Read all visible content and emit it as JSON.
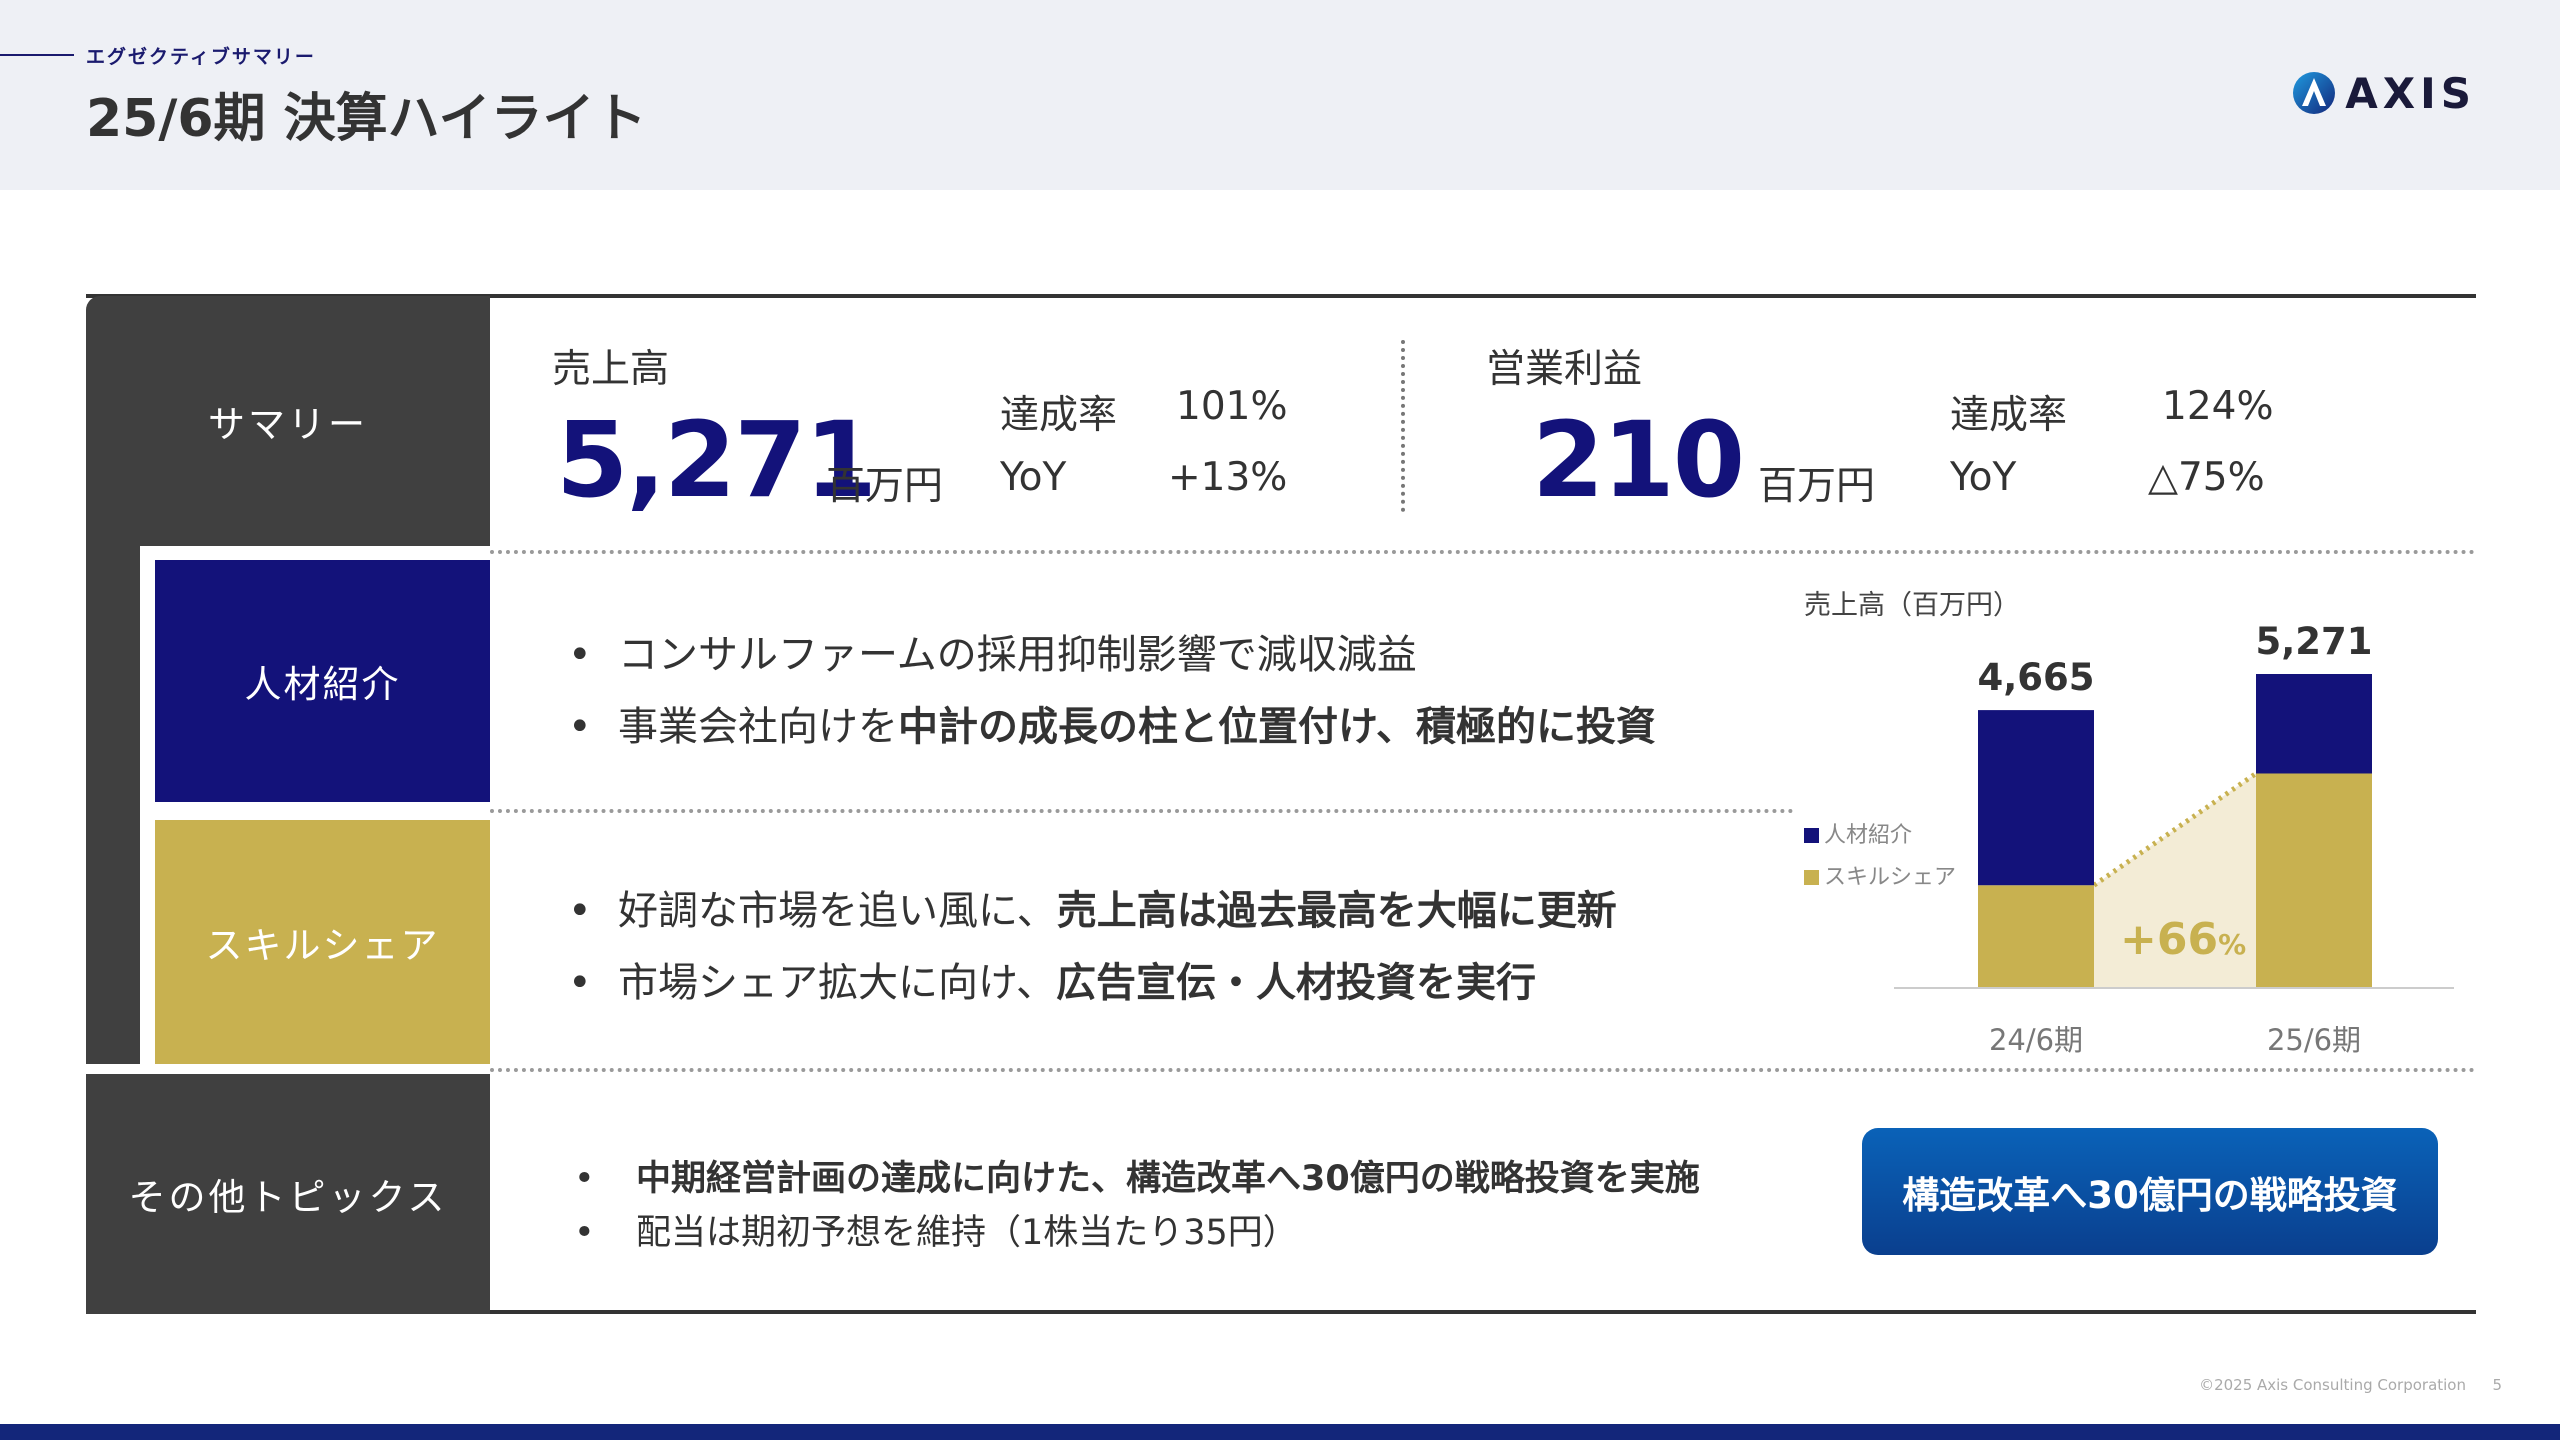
{
  "header": {
    "section_label": "エグゼクティブサマリー",
    "title": "25/6期 決算ハイライト",
    "logo_text": "AXIS",
    "logo_icon": "axis-logo-icon"
  },
  "summary": {
    "label": "サマリー",
    "sales": {
      "title": "売上高",
      "value": "5,271",
      "unit": "百万円",
      "achievement_label": "達成率",
      "achievement_value": "101%",
      "yoy_label": "YoY",
      "yoy_value": "+13%"
    },
    "op_income": {
      "title": "営業利益",
      "value": "210",
      "unit": "百万円",
      "achievement_label": "達成率",
      "achievement_value": "124%",
      "yoy_label": "YoY",
      "yoy_value": "△75%"
    }
  },
  "segments": {
    "talent": {
      "label": "人材紹介",
      "bullet1": "コンサルファームの採用抑制影響で減収減益",
      "bullet2_prefix": "事業会社向けを",
      "bullet2_bold": "中計の成長の柱と位置付け、積極的に投資"
    },
    "skillshare": {
      "label": "スキルシェア",
      "bullet1_prefix": "好調な市場を追い風に、",
      "bullet1_bold": "売上高は過去最高を大幅に更新",
      "bullet2_prefix": "市場シェア拡大に向け、",
      "bullet2_bold": "広告宣伝・人材投資を実行"
    }
  },
  "other": {
    "label": "その他トピックス",
    "bullet1": "中期経営計画の達成に向けた、構造改革へ30億円の戦略投資を実施",
    "bullet2": "配当は期初予想を維持（1株当たり35円）",
    "cta_label": "構造改革へ30億円の戦略投資"
  },
  "bullet_char": "•",
  "chart_data": {
    "type": "bar",
    "title": "売上高（百万円）",
    "categories": [
      "24/6期",
      "25/6期"
    ],
    "stacked": true,
    "series": [
      {
        "name": "人材紹介",
        "color": "#13127a",
        "values": [
          2940,
          1670
        ]
      },
      {
        "name": "スキルシェア",
        "color": "#c8b150",
        "values": [
          1725,
          3601
        ]
      }
    ],
    "totals": [
      4665,
      5271
    ],
    "total_labels": [
      "4,665",
      "5,271"
    ],
    "annotation": {
      "text": "+66",
      "suffix": "%",
      "series": "スキルシェア"
    },
    "ylim": [
      0,
      5271
    ],
    "legend": "left",
    "grid": false
  },
  "footer": {
    "copyright": "©2025 Axis Consulting Corporation",
    "page_number": "5"
  },
  "colors": {
    "navy": "#13127a",
    "gold": "#c8b150",
    "dark": "#404040",
    "cta": "#0a4fa0"
  }
}
